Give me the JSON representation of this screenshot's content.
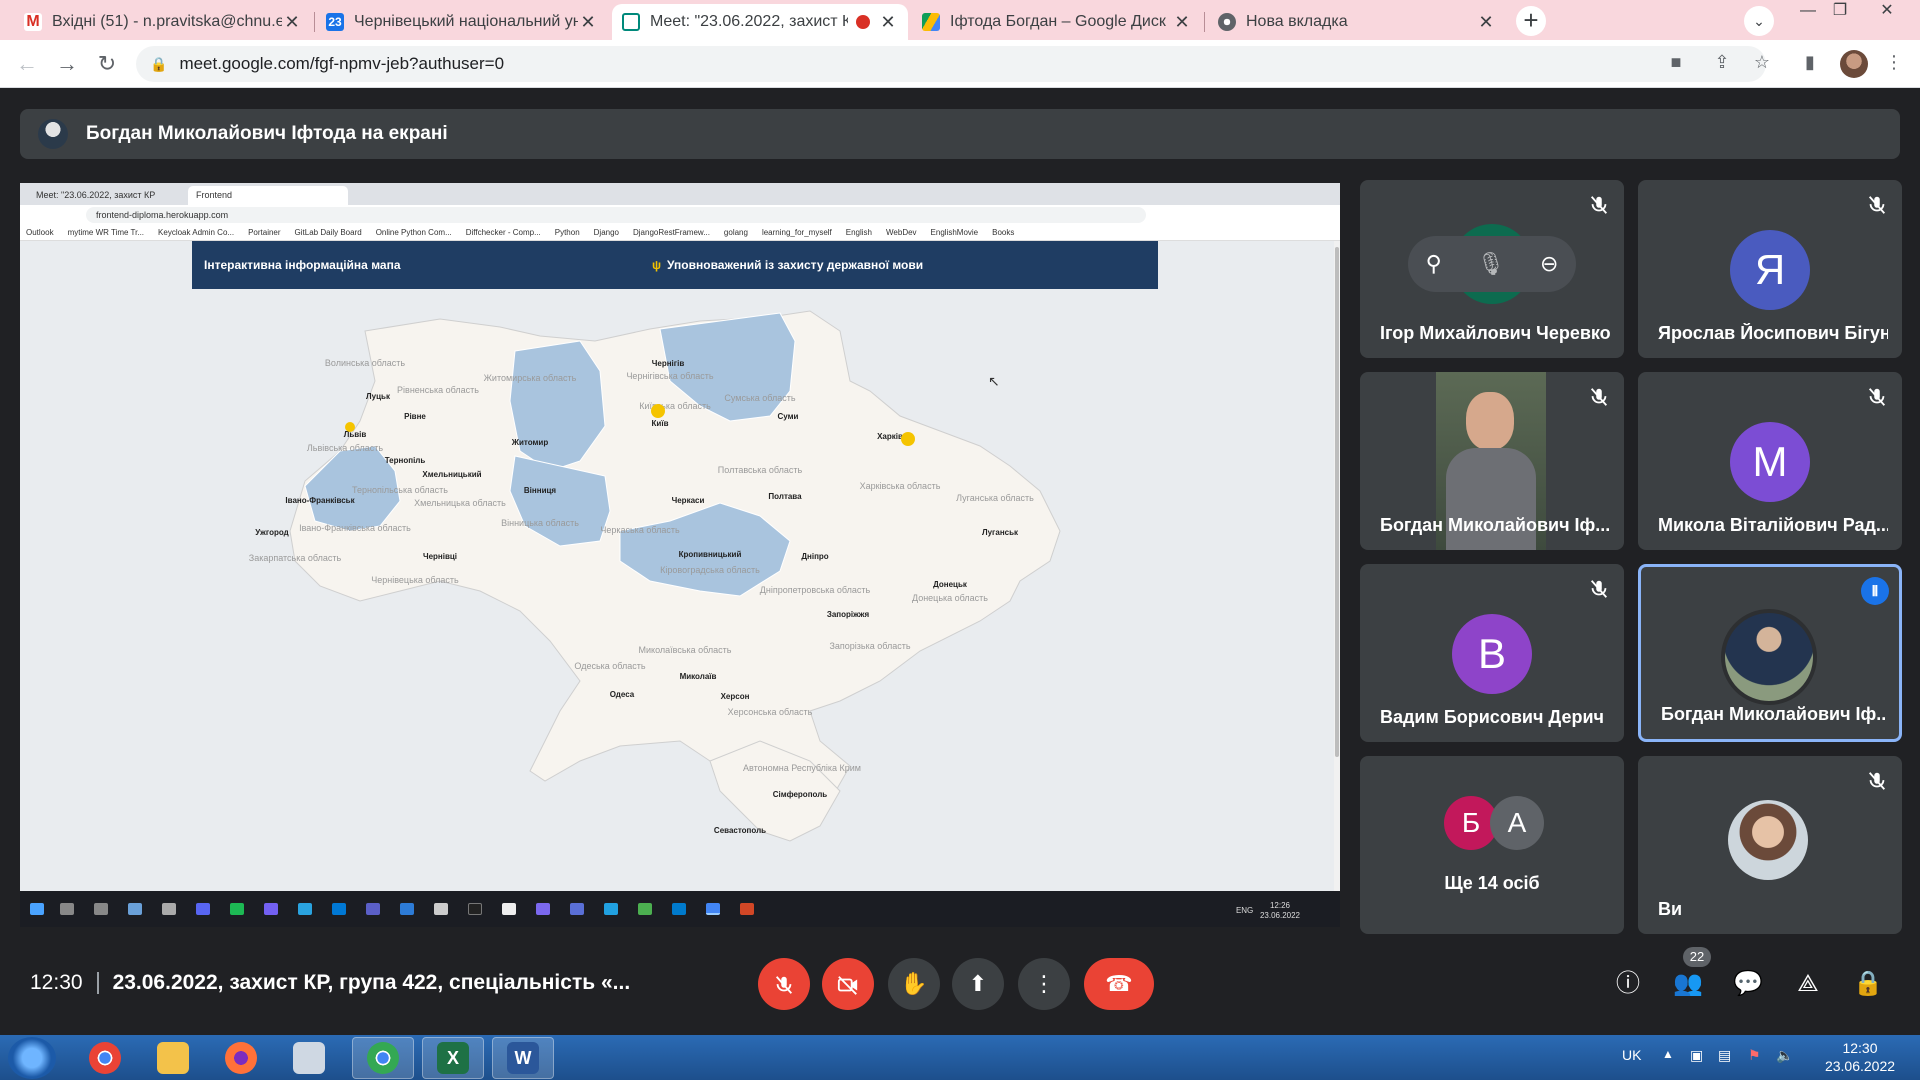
{
  "tabs": [
    {
      "title": "Вхідні (51) - n.pravitska@chnu.ed",
      "icon": "gmail-icon",
      "color": "#d93025"
    },
    {
      "title": "Чернівецький національний уні",
      "icon": "moodle-icon",
      "color": "#1a73e8"
    },
    {
      "title": "Meet: \"23.06.2022, захист КР",
      "icon": "meet-icon",
      "color": "#00897b"
    },
    {
      "title": "Іфтода Богдан – Google Диск",
      "icon": "drive-icon",
      "color": "#fbbc04"
    },
    {
      "title": "Нова вкладка",
      "icon": "chrome-icon",
      "color": "#5f6368"
    }
  ],
  "address": {
    "url": "meet.google.com/fgf-npmv-jeb?authuser=0"
  },
  "presenter_banner": "Богдан Миколайович Іфтода на екрані",
  "shared_screen": {
    "tabs": [
      "Meet: \"23.06.2022, захист КР",
      "Frontend"
    ],
    "url": "frontend-diploma.herokuapp.com",
    "bookmarks": [
      "Outlook",
      "mytime WR Time Tr...",
      "Keycloak Admin Co...",
      "Portainer",
      "GitLab Daily Board",
      "Online Python Com...",
      "Diffchecker - Comp...",
      "Python",
      "Django",
      "DjangoRestFramew...",
      "golang",
      "learning_for_myself",
      "English",
      "WebDev",
      "EnglishMovie",
      "Books"
    ],
    "header_left": "Інтерактивна інформаційна мапа",
    "header_right": "Уповноважений із захисту державної мови",
    "time": "12:26",
    "date": "23.06.2022",
    "lang": "ENG",
    "map_labels": [
      {
        "t": "Волинська область"
      },
      {
        "t": "Луцьк"
      },
      {
        "t": "Рівненська область"
      },
      {
        "t": "Рівне"
      },
      {
        "t": "Житомирська область"
      },
      {
        "t": "Житомир"
      },
      {
        "t": "Чернігів"
      },
      {
        "t": "Чернігівська область"
      },
      {
        "t": "Сумська область"
      },
      {
        "t": "Суми"
      },
      {
        "t": "Київська область"
      },
      {
        "t": "Київ"
      },
      {
        "t": "Львів"
      },
      {
        "t": "Львівська область"
      },
      {
        "t": "Тернопіль"
      },
      {
        "t": "Тернопільська область"
      },
      {
        "t": "Хмельницький"
      },
      {
        "t": "Хмельницька область"
      },
      {
        "t": "Вінниця"
      },
      {
        "t": "Вінницька область"
      },
      {
        "t": "Івано-Франківськ"
      },
      {
        "t": "Івано-Франківська область"
      },
      {
        "t": "Ужгород"
      },
      {
        "t": "Закарпатська область"
      },
      {
        "t": "Чернівці"
      },
      {
        "t": "Чернівецька область"
      },
      {
        "t": "Черкаси"
      },
      {
        "t": "Черкаська область"
      },
      {
        "t": "Полтавська область"
      },
      {
        "t": "Полтава"
      },
      {
        "t": "Харків"
      },
      {
        "t": "Харківська область"
      },
      {
        "t": "Луганська область"
      },
      {
        "t": "Луганськ"
      },
      {
        "t": "Кропивницький"
      },
      {
        "t": "Кіровоградська область"
      },
      {
        "t": "Дніпро"
      },
      {
        "t": "Дніпропетровська область"
      },
      {
        "t": "Донецьк"
      },
      {
        "t": "Донецька область"
      },
      {
        "t": "Запоріжжя"
      },
      {
        "t": "Запорізька область"
      },
      {
        "t": "Миколаївська область"
      },
      {
        "t": "Миколаїв"
      },
      {
        "t": "Одеська область"
      },
      {
        "t": "Одеса"
      },
      {
        "t": "Херсон"
      },
      {
        "t": "Херсонська область"
      },
      {
        "t": "Автономна Республіка Крим"
      },
      {
        "t": "Сімферополь"
      },
      {
        "t": "Севастополь"
      }
    ]
  },
  "participants": [
    {
      "name": "Ігор Михайлович Черевко"
    },
    {
      "name": "Ярослав Йосипович Бігун",
      "initial": "Я"
    },
    {
      "name": "Богдан Миколайович Іф..."
    },
    {
      "name": "Микола Віталійович Рад...",
      "initial": "М"
    },
    {
      "name": "Вадим Борисович Дерич",
      "initial": "В"
    },
    {
      "name": "Богдан Миколайович Іф..."
    },
    {
      "name": "Ще 14 осіб",
      "initials": [
        "Б",
        "А"
      ]
    },
    {
      "name": "Ви"
    }
  ],
  "bottom": {
    "time": "12:30",
    "meeting_title": "23.06.2022, захист КР, група 422, спеціальність «...",
    "people_count": "22"
  },
  "taskbar": {
    "lang": "UK",
    "time": "12:30",
    "date": "23.06.2022"
  },
  "colors": {
    "map_blue": "#a9c4de",
    "map_fill": "#f7f4ef",
    "accent": "#1a73e8",
    "danger": "#ea4335"
  }
}
